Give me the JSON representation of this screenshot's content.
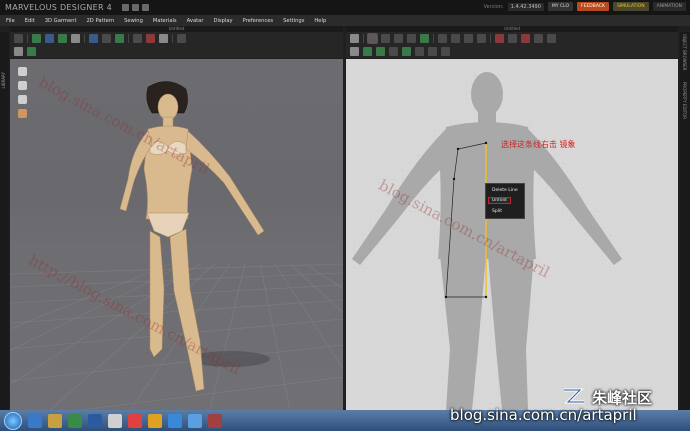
{
  "app": {
    "title": "MARVELOUS DESIGNER 4",
    "version_label": "Version:",
    "version_value": "1.4.42.3490"
  },
  "title_buttons": {
    "my_clo": "MY CLO",
    "feedback": "FEEDBACK",
    "simulation": "SIMULATION",
    "animation": "ANIMATION"
  },
  "menu": [
    "File",
    "Edit",
    "3D Garment",
    "2D Pattern",
    "Sewing",
    "Materials",
    "Avatar",
    "Display",
    "Preferences",
    "Settings",
    "Help"
  ],
  "panels": {
    "left_header": "Untitled",
    "right_header": "Untitled"
  },
  "side_tabs": {
    "left": "LIBRARY",
    "right_top": "OBJECT BROWSER",
    "right_bottom": "PROPERTY EDITOR"
  },
  "pattern": {
    "annotation": "选择这条线右击  镜象"
  },
  "context_menu": {
    "items": [
      "Delete Line",
      "Unfold",
      "Split"
    ],
    "highlighted": "Unfold"
  },
  "watermarks": {
    "blog": "blog.sina.com.cn/artapril",
    "blog_http": "http://blog.sina.com.cn/artapril",
    "brand_name": "朱峰社区",
    "brand_url": "blog.sina.com.cn/artapril"
  },
  "colors": {
    "accent_red": "#d02020",
    "feedback": "#b84a1e",
    "mirror_line": "#f0c020"
  }
}
